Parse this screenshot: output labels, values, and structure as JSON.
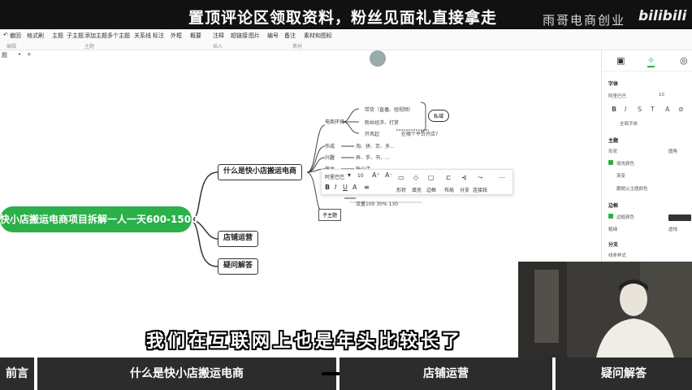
{
  "banner": {
    "text": "置顶评论区领取资料，粉丝见面礼直接拿走",
    "brand": "雨哥电商创业",
    "platform": "bilibili"
  },
  "toolbar": {
    "items": [
      "撤回",
      "格式刷",
      "主题",
      "子主题",
      "添加主题",
      "多个主题",
      "关系线",
      "标注",
      "外框",
      "概要",
      "注释",
      "超链接",
      "图片",
      "编号",
      "备注",
      "素材和图标"
    ],
    "groups": [
      "编辑",
      "主题",
      "插入",
      "素材"
    ]
  },
  "subbar": {
    "left": "题",
    "plus": "+"
  },
  "avatar_label": "",
  "mindmap": {
    "root": "快小店搬运电商项目拆解一人一天600-1500",
    "main": [
      "什么是快小店搬运电商",
      "店铺运营",
      "疑问解答"
    ],
    "sub": [
      "电商环境",
      "作成",
      "兴趣",
      "平台"
    ],
    "leaves": [
      "带货（直播、短视频）",
      "粉丝经济、打赏",
      "开风起",
      "在哪个平台开店?"
    ],
    "leaf_rows": [
      "淘、拼、京、多...",
      "弄、手、书、...",
      "快小店"
    ],
    "tag": "私域",
    "edit_node": "子主题",
    "stats": "流量100   30%   130"
  },
  "float_toolbar": {
    "font": "阿里巴巴",
    "size": "10",
    "actions": [
      "形状",
      "填充",
      "边框",
      "布局",
      "分支",
      "连接线"
    ]
  },
  "panel": {
    "section_font": "字体",
    "font_value": "阿里巴巴",
    "size_value": "10",
    "theme_label": "全局字体",
    "section_theme": "主题",
    "theme_shape": "形状",
    "theme_shape_value": "圆角",
    "fill_label": "填充颜色",
    "fill_sub": "渐变",
    "fill_value": "跟随父主题颜色",
    "section_border": "边框",
    "border_label": "边框颜色",
    "border_width": "粗细",
    "border_style": "虚线",
    "section_branch": "分支",
    "branch_value": "线条样式"
  },
  "subtitle": "我们在互联网上也是年头比较长了",
  "chapters": [
    "前言",
    "什么是快小店搬运电商",
    "店铺运营",
    "疑问解答"
  ],
  "colors": {
    "accent": "#2bb04a",
    "chapter_bg": "#2c2c2c"
  }
}
